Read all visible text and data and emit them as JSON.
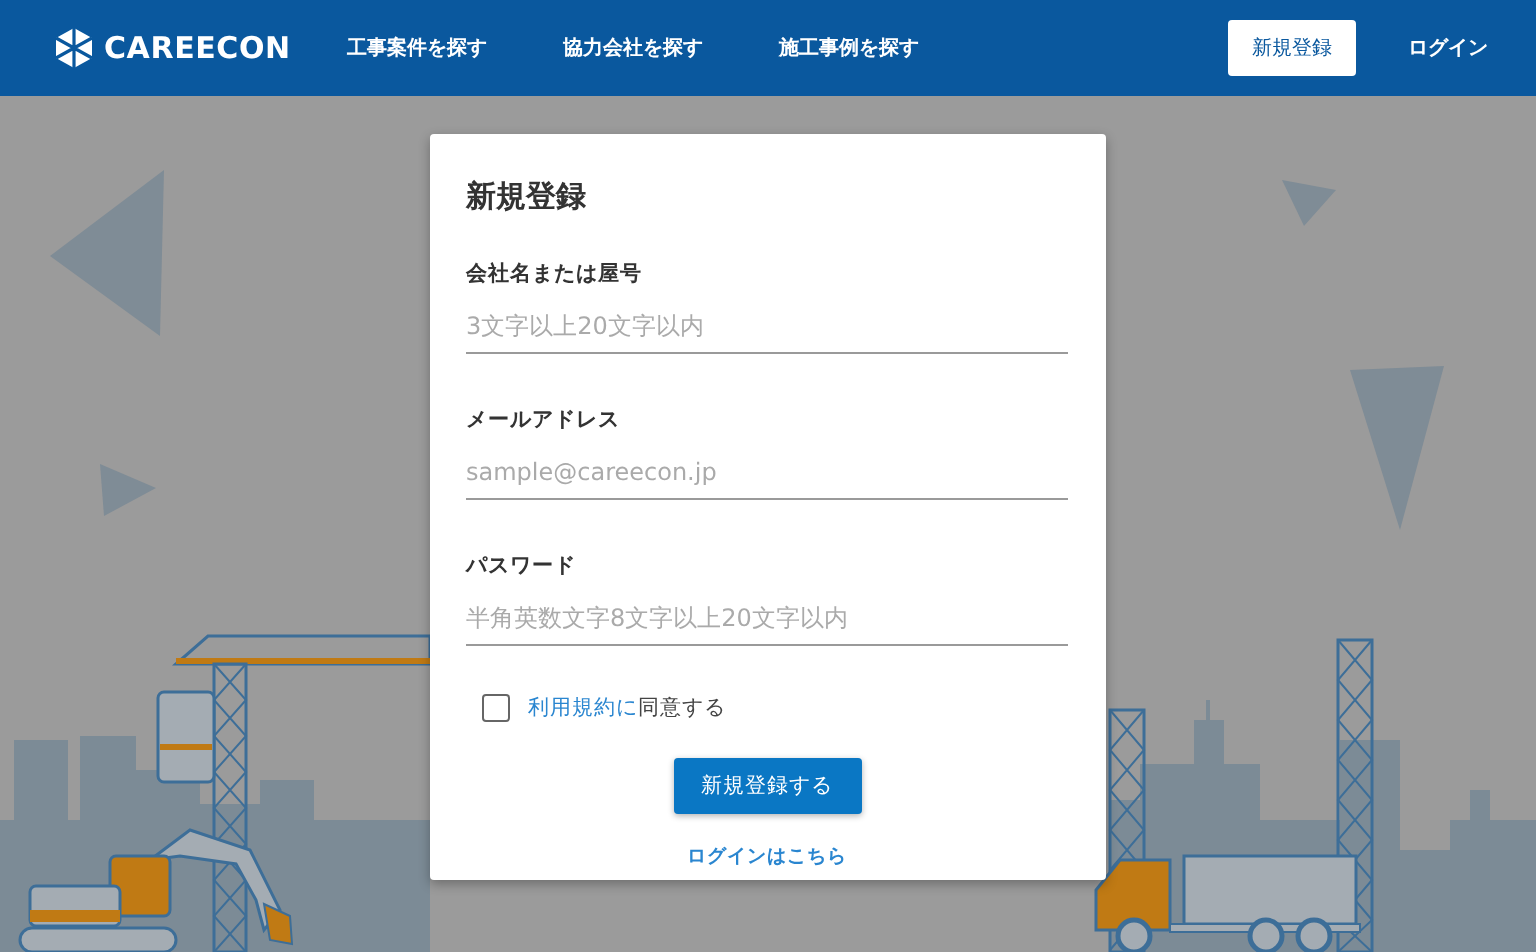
{
  "header": {
    "logo": "CAREECON",
    "nav": [
      "工事案件を探す",
      "協力会社を探す",
      "施工事例を探す"
    ],
    "signup_button": "新規登録",
    "login_link": "ログイン"
  },
  "dialog": {
    "title": "新規登録",
    "fields": [
      {
        "label": "会社名または屋号",
        "placeholder": "3文字以上20文字以内"
      },
      {
        "label": "メールアドレス",
        "placeholder": "sample@careecon.jp"
      },
      {
        "label": "パスワード",
        "placeholder": "半角英数文字8文字以上20文字以内"
      }
    ],
    "terms": {
      "checked": false,
      "link": "利用規約に",
      "text": "同意する"
    },
    "submit": "新規登録する",
    "login_link": "ログインはこちら"
  }
}
